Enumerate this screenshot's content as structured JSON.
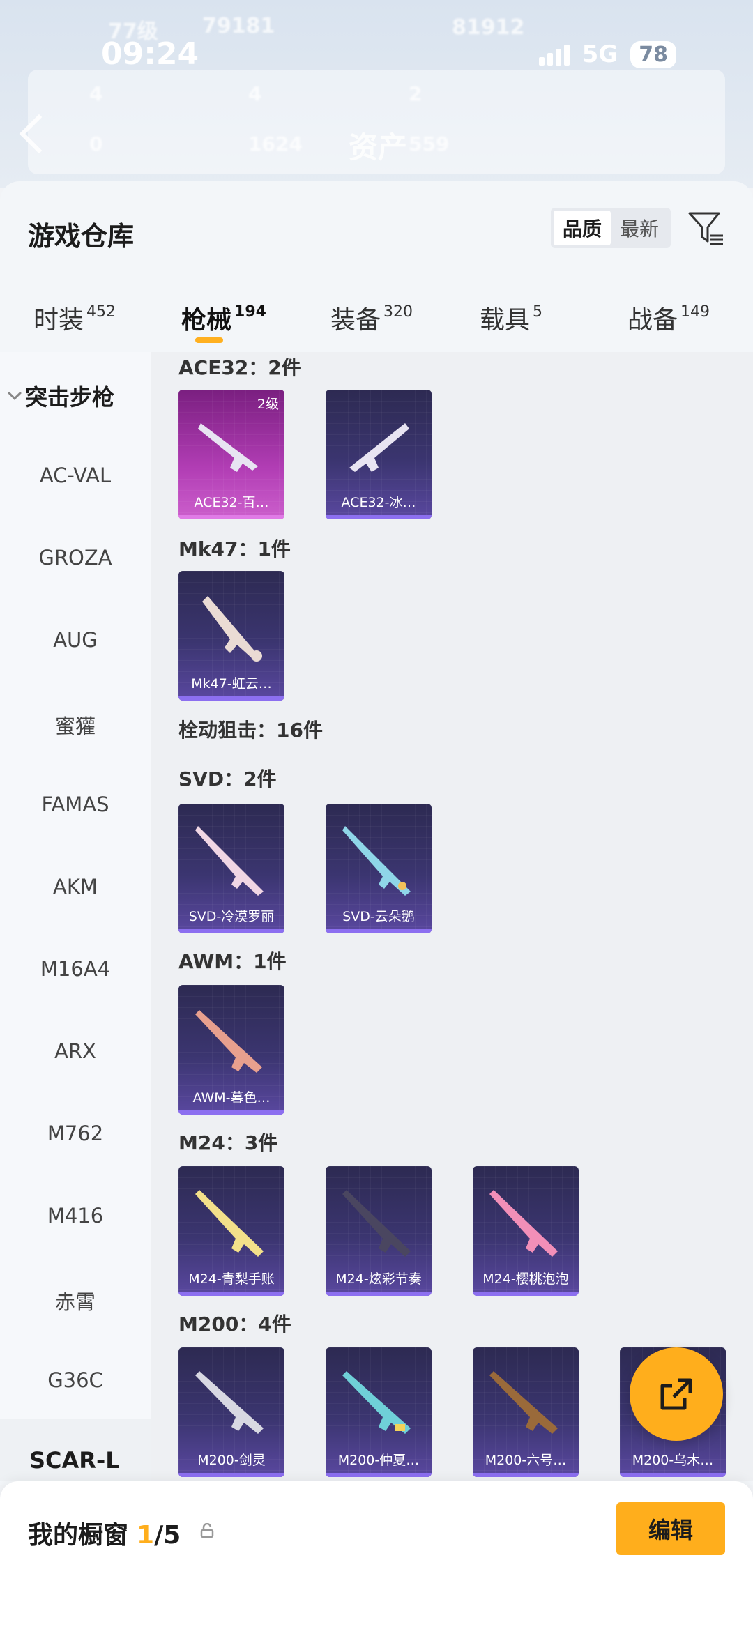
{
  "status_bar": {
    "time": "09:24",
    "network": "5G",
    "battery": "78"
  },
  "background_header": {
    "title": "资产",
    "ghost_texts": [
      "77级",
      "79181",
      "81912",
      "4",
      "4",
      "2",
      "0",
      "1624",
      "559"
    ]
  },
  "sheet": {
    "title": "游戏仓库",
    "sort_options": [
      "品质",
      "最新"
    ],
    "active_sort": "品质"
  },
  "tabs": [
    {
      "label": "时装",
      "count": "452"
    },
    {
      "label": "枪械",
      "count": "194"
    },
    {
      "label": "装备",
      "count": "320"
    },
    {
      "label": "载具",
      "count": "5"
    },
    {
      "label": "战备",
      "count": "149"
    }
  ],
  "sidebar": {
    "group": "突击步枪",
    "items": [
      "AC-VAL",
      "GROZA",
      "AUG",
      "蜜獾",
      "FAMAS",
      "AKM",
      "M16A4",
      "ARX",
      "M762",
      "M416",
      "赤霄",
      "G36C"
    ],
    "next_group": "SCAR-L"
  },
  "content": {
    "groups": [
      {
        "label": "ACE32：2件",
        "items": [
          {
            "name": "ACE32-百…",
            "level": "2级"
          },
          {
            "name": "ACE32-冰…"
          }
        ]
      },
      {
        "label": "Mk47：1件",
        "items": [
          {
            "name": "Mk47-虹云…"
          }
        ]
      },
      {
        "label": "栓动狙击：16件"
      },
      {
        "label": "SVD：2件",
        "items": [
          {
            "name": "SVD-冷漠罗丽"
          },
          {
            "name": "SVD-云朵鹅"
          }
        ]
      },
      {
        "label": "AWM：1件",
        "items": [
          {
            "name": "AWM-暮色…"
          }
        ]
      },
      {
        "label": "M24：3件",
        "items": [
          {
            "name": "M24-青梨手账"
          },
          {
            "name": "M24-炫彩节奏"
          },
          {
            "name": "M24-樱桃泡泡"
          }
        ]
      },
      {
        "label": "M200：4件",
        "items": [
          {
            "name": "M200-剑灵"
          },
          {
            "name": "M200-仲夏…"
          },
          {
            "name": "M200-六号…"
          },
          {
            "name": "M200-乌木…"
          }
        ]
      }
    ]
  },
  "bottom_bar": {
    "title": "我的橱窗",
    "current": "1",
    "separator": "/5",
    "edit_label": "编辑"
  }
}
